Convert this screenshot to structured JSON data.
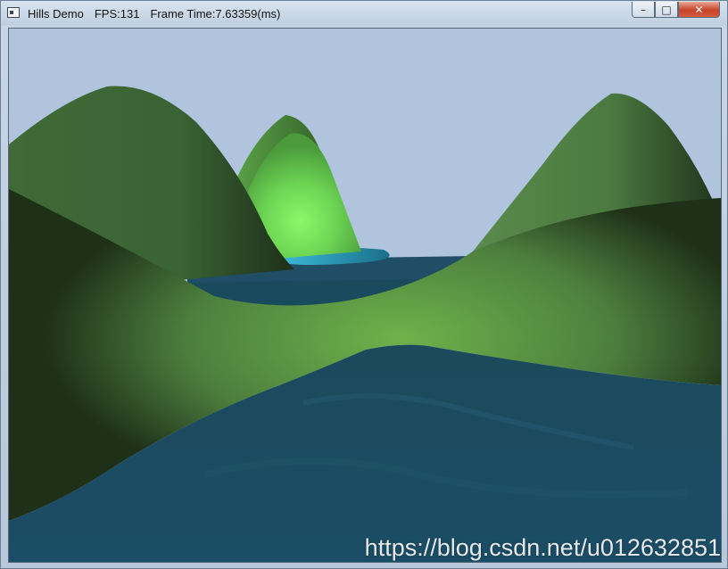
{
  "window": {
    "app_name": "Hills Demo",
    "fps": "FPS:131",
    "frame_time": "Frame Time:7.63359(ms)",
    "minimize_glyph": "–",
    "maximize_glyph": "□",
    "close_glyph": "✕",
    "icon": "app-window-icon"
  },
  "scene": {
    "sky_color": "#b0c4de",
    "water_color": "#1f4e66",
    "hill_color": "#4f7a45",
    "highlight_color": "#7fe35a"
  },
  "watermark": "https://blog.csdn.net/u012632851"
}
